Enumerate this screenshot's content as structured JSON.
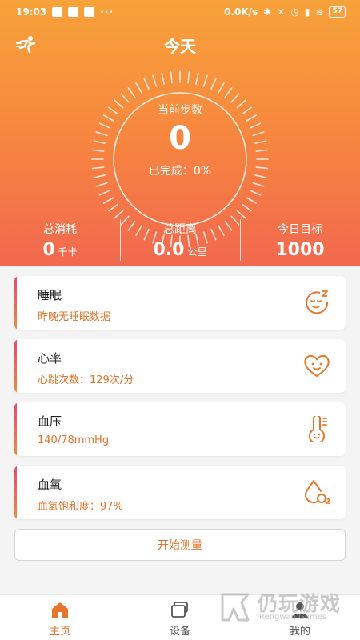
{
  "status_bar": {
    "time": "19:03",
    "dots": "···",
    "network_speed": "0.0K/s",
    "battery": "57"
  },
  "header": {
    "title": "今天"
  },
  "steps": {
    "label": "当前步数",
    "value": "0",
    "completion": "已完成：0%",
    "completion_fraction": 0
  },
  "stats": [
    {
      "label": "总消耗",
      "value": "0",
      "unit": "千卡"
    },
    {
      "label": "总距离",
      "value": "0.0",
      "unit": "公里"
    },
    {
      "label": "今日目标",
      "value": "1000",
      "unit": ""
    }
  ],
  "cards": [
    {
      "title": "睡眠",
      "subtitle": "昨晚无睡眠数据",
      "icon": "sleep-face-icon"
    },
    {
      "title": "心率",
      "subtitle": "心跳次数：129次/分",
      "icon": "heart-face-icon"
    },
    {
      "title": "血压",
      "subtitle": "140/78mmHg",
      "icon": "thermometer-face-icon"
    },
    {
      "title": "血氧",
      "subtitle": "血氧饱和度：97%",
      "icon": "oxygen-drop-icon"
    }
  ],
  "measure_button": {
    "label": "开始测量"
  },
  "tabs": [
    {
      "label": "主页",
      "icon": "home-icon",
      "active": true
    },
    {
      "label": "设备",
      "icon": "device-icon",
      "active": false
    },
    {
      "label": "我的",
      "icon": "profile-icon",
      "active": false
    }
  ],
  "watermark": {
    "text": "仍玩游戏",
    "subtext": "Rengwan Games"
  },
  "colors": {
    "accent": "#e8762a",
    "header_top": "#f7a23a",
    "header_bottom": "#f2684f",
    "card_bar_top": "#e9486a"
  }
}
